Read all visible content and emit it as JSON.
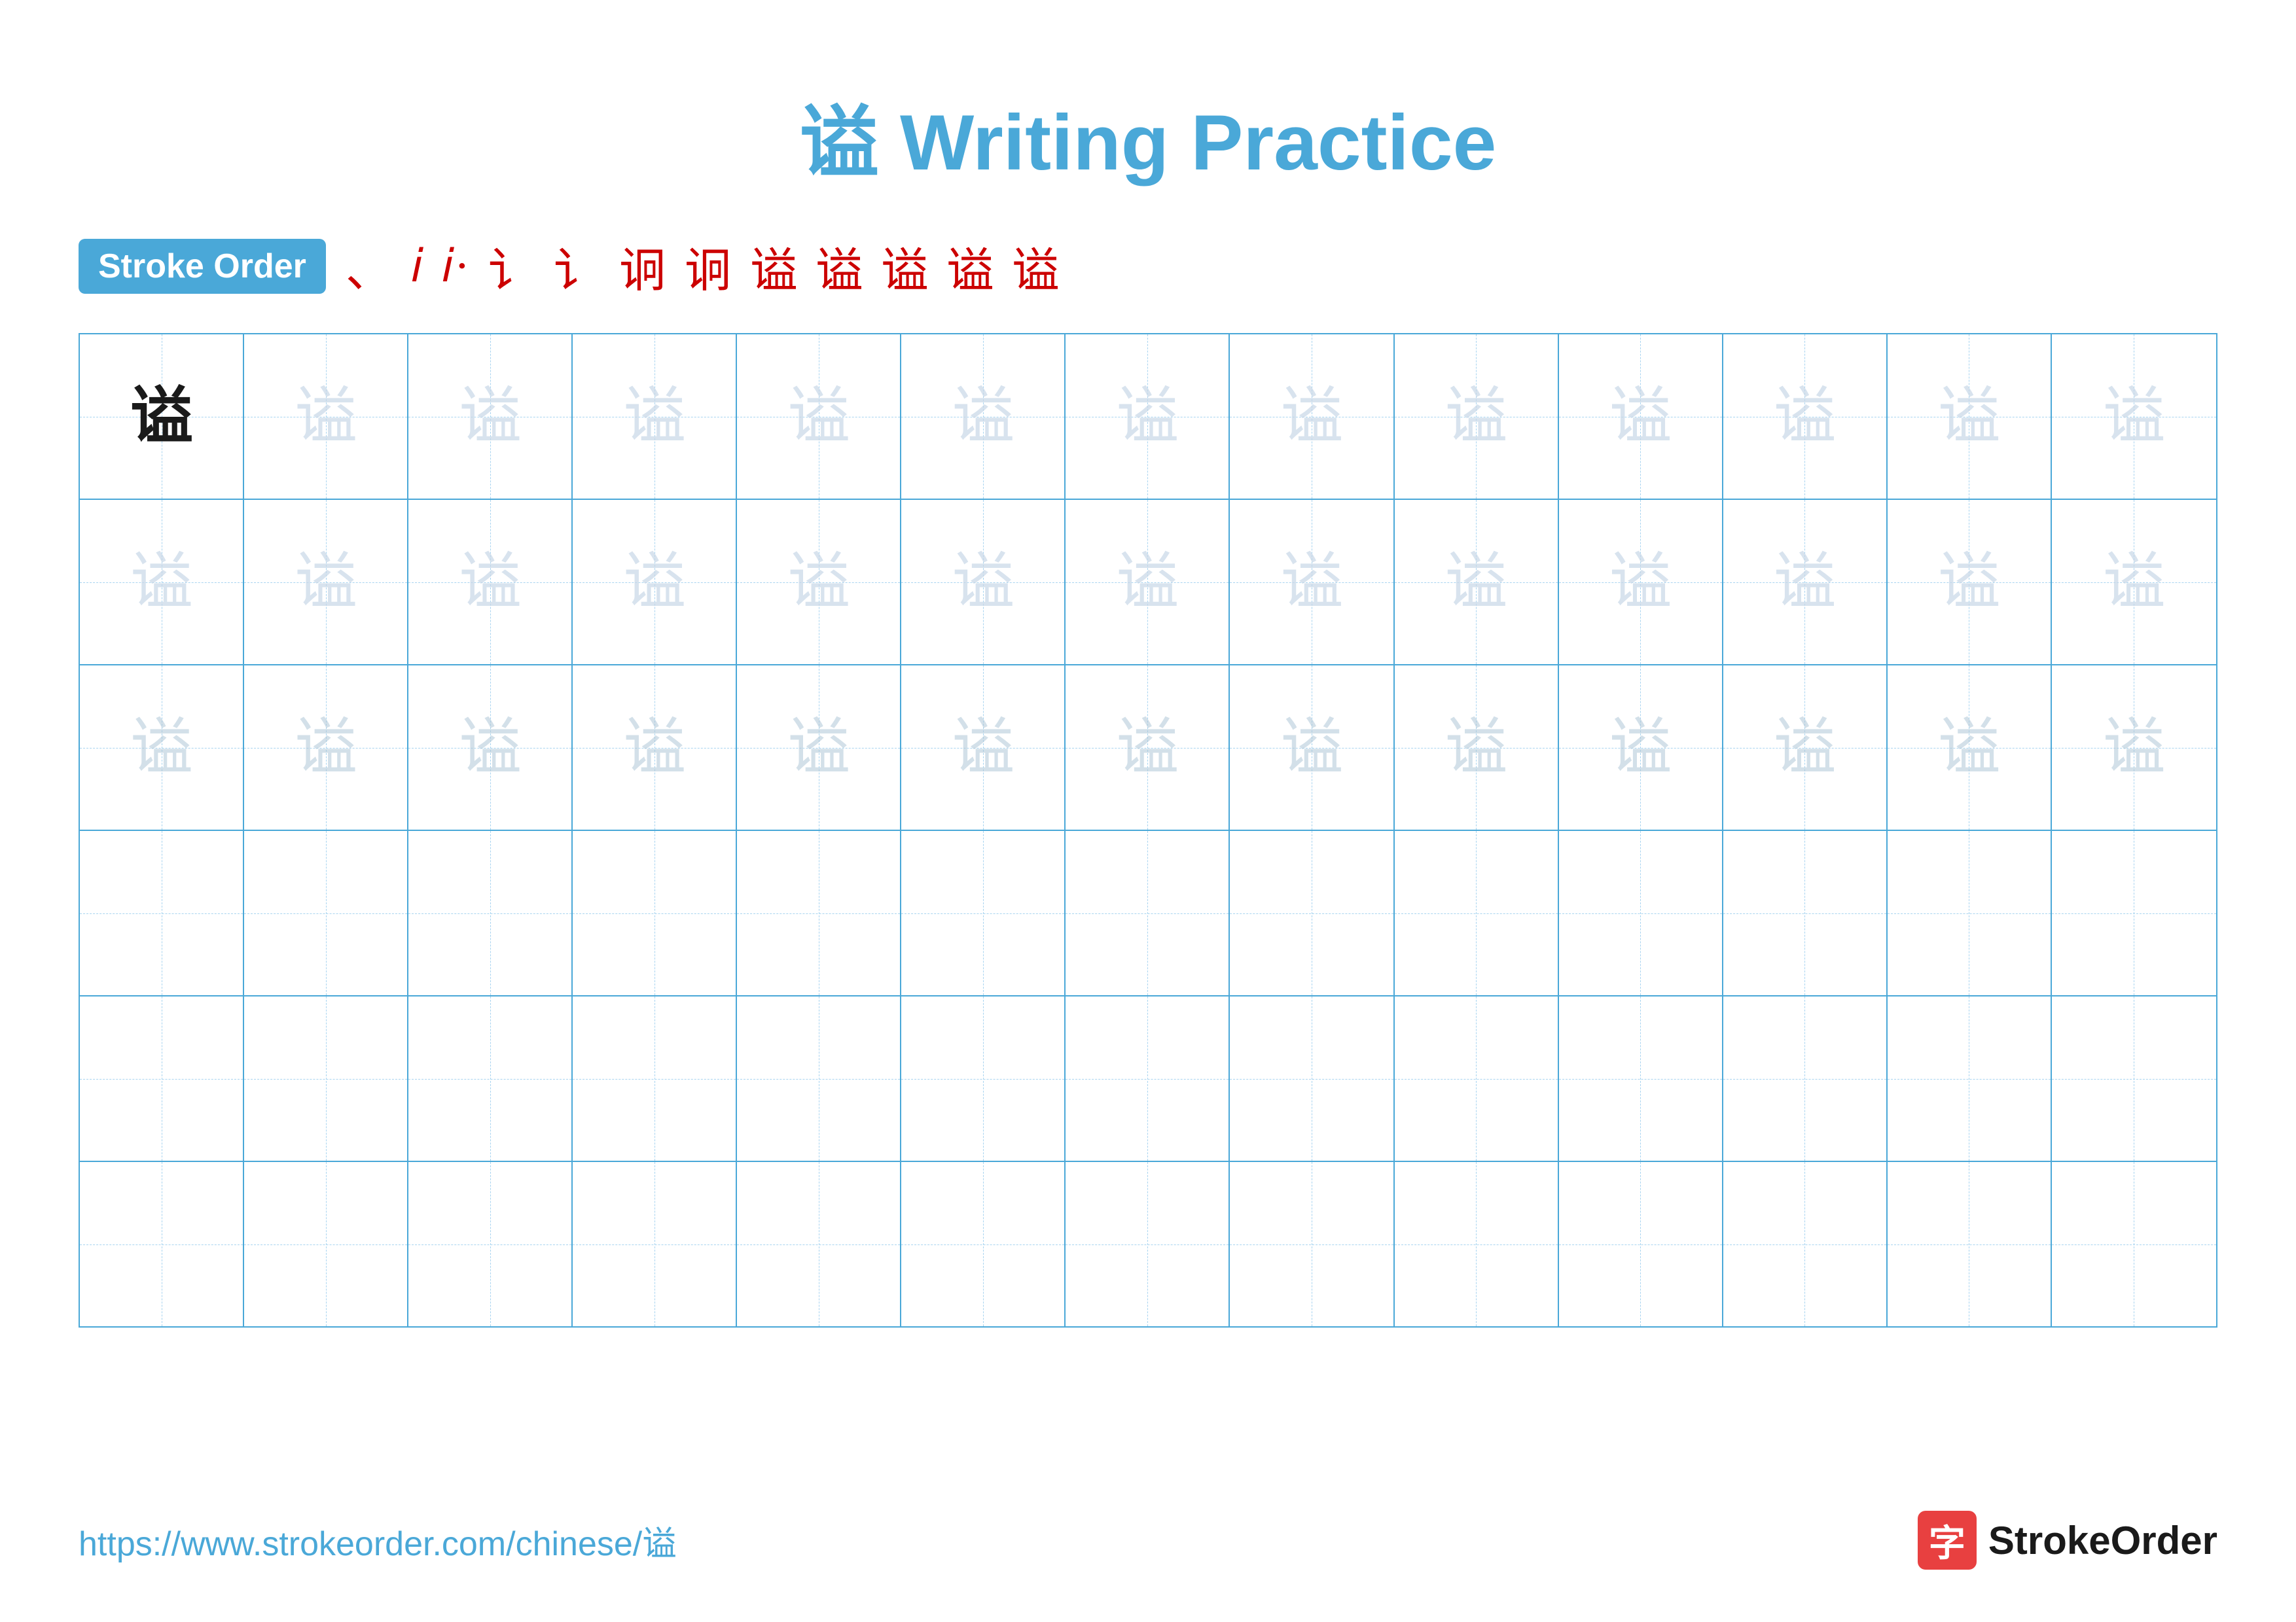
{
  "title": "谥 Writing Practice",
  "stroke_order_badge": "Stroke Order",
  "stroke_sequence": [
    "、",
    "i",
    "i·",
    "讠",
    "讠·",
    "讠·-",
    "讠益",
    "讠益·",
    "谥·",
    "谥·",
    "谥·",
    "谥"
  ],
  "character": "谥",
  "footer_url": "https://www.strokeorder.com/chinese/谥",
  "footer_logo_text": "StrokeOrder",
  "rows": [
    {
      "type": "solid_then_light",
      "first_solid": true
    },
    {
      "type": "light"
    },
    {
      "type": "medium"
    },
    {
      "type": "empty"
    },
    {
      "type": "empty"
    },
    {
      "type": "empty"
    }
  ],
  "cols": 13
}
